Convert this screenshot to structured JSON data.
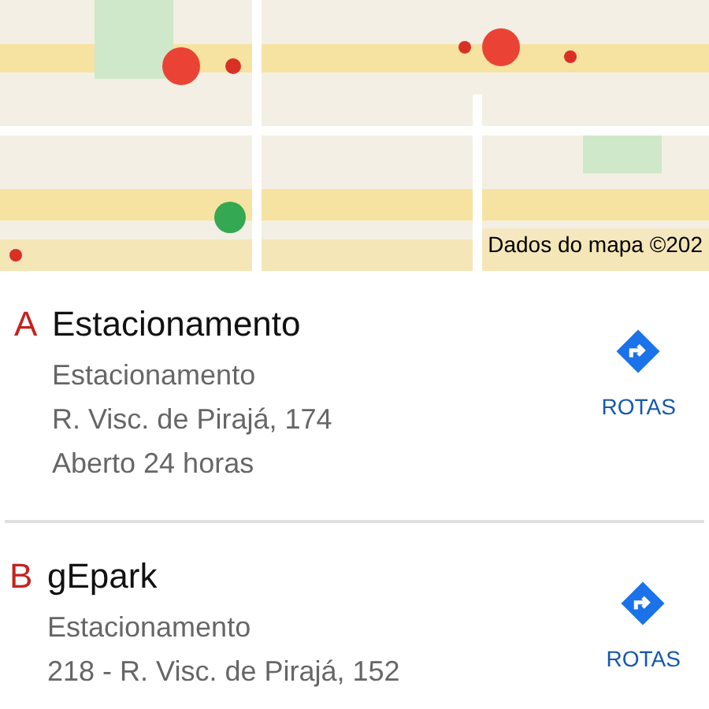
{
  "map": {
    "attribution": "Dados do mapa ©202"
  },
  "results": [
    {
      "letter": "A",
      "name": "Estacionamento",
      "details": [
        "Estacionamento",
        "R. Visc. de Pirajá, 174",
        "Aberto 24 horas"
      ],
      "action": "ROTAS"
    },
    {
      "letter": "B",
      "name": "gEpark",
      "details": [
        "Estacionamento",
        "218 - R. Visc. de Pirajá, 152"
      ],
      "action": "ROTAS"
    }
  ]
}
